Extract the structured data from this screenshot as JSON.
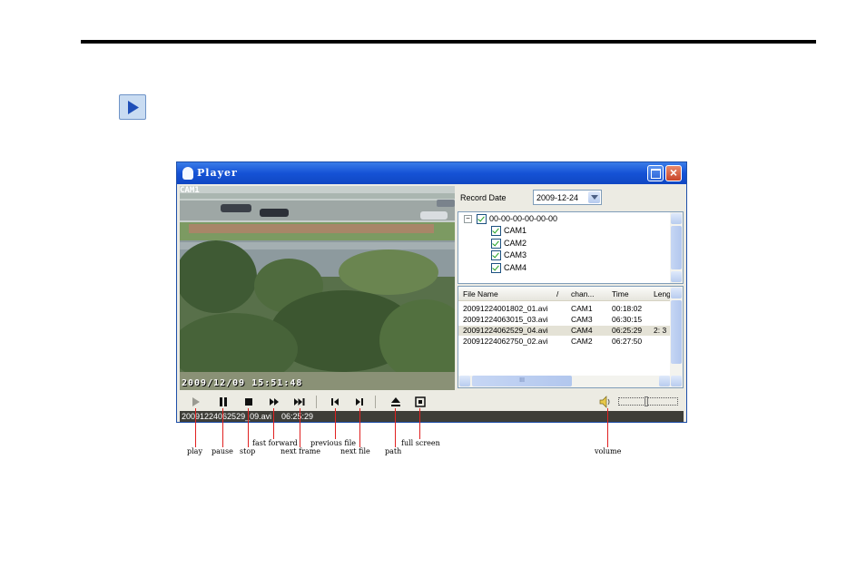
{
  "window": {
    "title": "Player"
  },
  "video": {
    "camera_label": "CAM1",
    "osd_timestamp": "2009/12/09 15:51:48"
  },
  "record_date": {
    "label": "Record Date",
    "value": "2009-12-24"
  },
  "tree": {
    "root": "00-00-00-00-00-00",
    "cameras": [
      "CAM1",
      "CAM2",
      "CAM3",
      "CAM4"
    ]
  },
  "file_list": {
    "headers": [
      "File Name",
      "chan...",
      "Time",
      "Leng"
    ],
    "sort_indicator": "/",
    "rows": [
      [
        "20091224001802_01.avi",
        "CAM1",
        "00:18:02",
        ""
      ],
      [
        "20091224063015_03.avi",
        "CAM3",
        "06:30:15",
        ""
      ],
      [
        "20091224062529_04.avi",
        "CAM4",
        "06:25:29",
        "2: 3"
      ],
      [
        "20091224062750_02.avi",
        "CAM2",
        "06:27:50",
        ""
      ]
    ],
    "selected_index": 2,
    "hscroll_thumb": "III"
  },
  "status": {
    "file": "20091224062529_09.avi",
    "time": "06:25:29"
  },
  "volume": {
    "level": 0.45
  },
  "annotations": {
    "play": "play",
    "pause": "pause",
    "stop": "stop",
    "fast_forward": "fast forward",
    "next_frame": "next frame",
    "previous_file": "previous file",
    "next_file": "next file",
    "path": "path",
    "full_screen": "full screen",
    "volume": "volume"
  },
  "colors": {
    "titlebar": "#1552d6",
    "callout": "#e02020",
    "status_bg": "#3e3e38"
  }
}
